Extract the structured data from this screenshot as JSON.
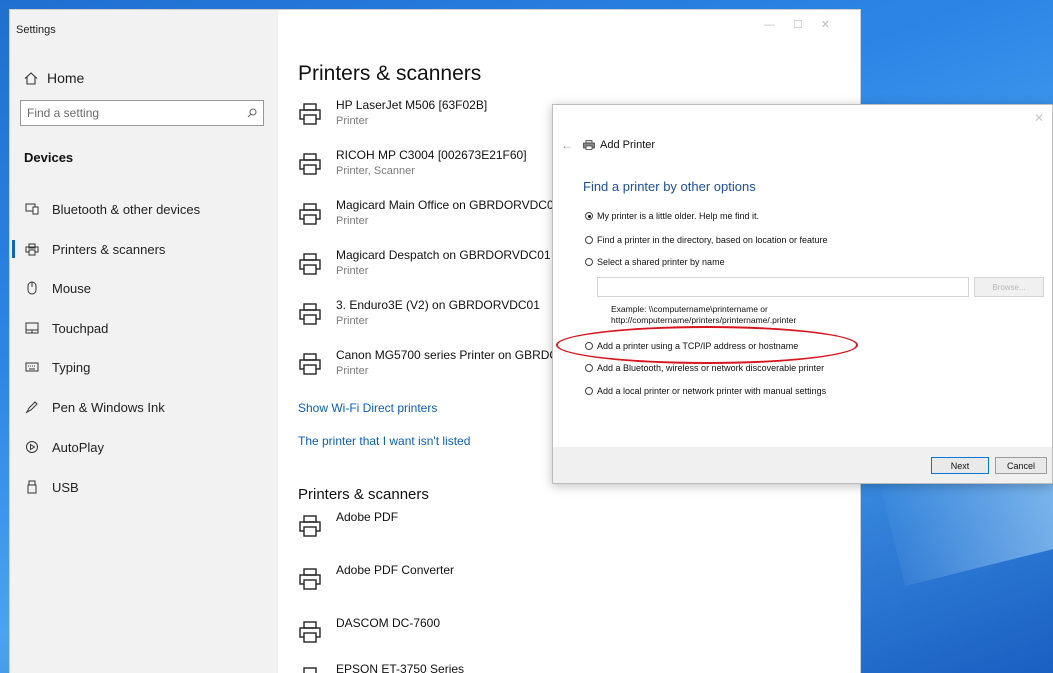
{
  "settings": {
    "window_title": "Settings",
    "search": {
      "placeholder": "Find a setting",
      "value": ""
    },
    "section": "Devices",
    "nav": [
      {
        "label": "Home",
        "icon": "home-icon"
      },
      {
        "label": "Bluetooth & other devices",
        "icon": "bluetooth-devices-icon"
      },
      {
        "label": "Printers & scanners",
        "icon": "printer-icon",
        "active": true
      },
      {
        "label": "Mouse",
        "icon": "mouse-icon"
      },
      {
        "label": "Touchpad",
        "icon": "touchpad-icon"
      },
      {
        "label": "Typing",
        "icon": "keyboard-icon"
      },
      {
        "label": "Pen & Windows Ink",
        "icon": "pen-icon"
      },
      {
        "label": "AutoPlay",
        "icon": "autoplay-icon"
      },
      {
        "label": "USB",
        "icon": "usb-icon"
      }
    ]
  },
  "main": {
    "title": "Printers & scanners",
    "printers": [
      {
        "name": "HP LaserJet M506 [63F02B]",
        "sub": "Printer"
      },
      {
        "name": "RICOH MP C3004 [002673E21F60]",
        "sub": "Printer, Scanner"
      },
      {
        "name": "Magicard Main Office on GBRDORVDC0",
        "sub": "Printer"
      },
      {
        "name": "Magicard Despatch on GBRDORVDC01",
        "sub": "Printer"
      },
      {
        "name": "3. Enduro3E (V2) on GBRDORVDC01",
        "sub": "Printer"
      },
      {
        "name": "Canon MG5700 series Printer on GBRDC",
        "sub": "Printer"
      }
    ],
    "link_wifi_direct": "Show Wi-Fi Direct printers",
    "link_not_listed": "The printer that I want isn't listed",
    "section2_title": "Printers & scanners",
    "printers2": [
      {
        "name": "Adobe PDF"
      },
      {
        "name": "Adobe PDF Converter"
      },
      {
        "name": "DASCOM DC-7600"
      },
      {
        "name": "EPSON ET-3750 Series"
      }
    ]
  },
  "dialog": {
    "title": "Add Printer",
    "heading": "Find a printer by other options",
    "options": [
      {
        "label": "My printer is a little older. Help me find it.",
        "selected": true
      },
      {
        "label": "Find a printer in the directory, based on location or feature",
        "selected": false
      },
      {
        "label": "Select a shared printer by name",
        "selected": false
      },
      {
        "label": "Add a printer using a TCP/IP address or hostname",
        "selected": false
      },
      {
        "label": "Add a Bluetooth, wireless or network discoverable printer",
        "selected": false
      },
      {
        "label": "Add a local printer or network printer with manual settings",
        "selected": false
      }
    ],
    "shared_name_value": "",
    "browse_label": "Browse...",
    "example_line1": "Example: \\\\computername\\printername or",
    "example_line2": "http://computername/printers/printername/.printer",
    "next_label": "Next",
    "cancel_label": "Cancel"
  },
  "colors": {
    "accent": "#0067c0",
    "link": "#0a5fb8",
    "annotation": "#d7161f"
  }
}
